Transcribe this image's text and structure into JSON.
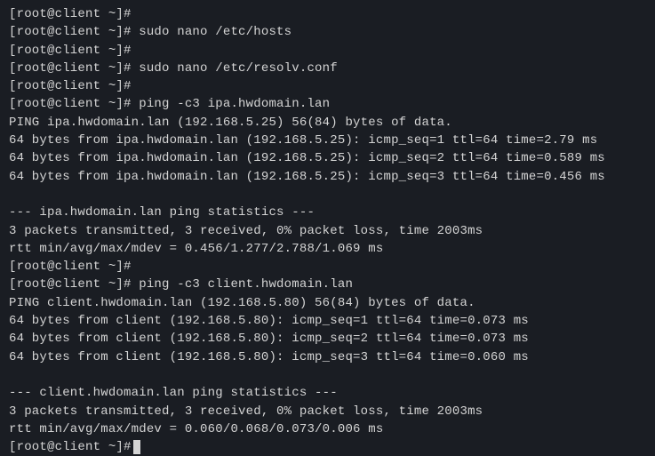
{
  "prompt": "[root@client ~]#",
  "lines": [
    {
      "type": "prompt",
      "cmd": ""
    },
    {
      "type": "prompt",
      "cmd": " sudo nano /etc/hosts"
    },
    {
      "type": "prompt",
      "cmd": ""
    },
    {
      "type": "prompt",
      "cmd": " sudo nano /etc/resolv.conf"
    },
    {
      "type": "prompt",
      "cmd": ""
    },
    {
      "type": "prompt",
      "cmd": " ping -c3 ipa.hwdomain.lan"
    },
    {
      "type": "out",
      "text": "PING ipa.hwdomain.lan (192.168.5.25) 56(84) bytes of data."
    },
    {
      "type": "out",
      "text": "64 bytes from ipa.hwdomain.lan (192.168.5.25): icmp_seq=1 ttl=64 time=2.79 ms"
    },
    {
      "type": "out",
      "text": "64 bytes from ipa.hwdomain.lan (192.168.5.25): icmp_seq=2 ttl=64 time=0.589 ms"
    },
    {
      "type": "out",
      "text": "64 bytes from ipa.hwdomain.lan (192.168.5.25): icmp_seq=3 ttl=64 time=0.456 ms"
    },
    {
      "type": "out",
      "text": ""
    },
    {
      "type": "out",
      "text": "--- ipa.hwdomain.lan ping statistics ---"
    },
    {
      "type": "out",
      "text": "3 packets transmitted, 3 received, 0% packet loss, time 2003ms"
    },
    {
      "type": "out",
      "text": "rtt min/avg/max/mdev = 0.456/1.277/2.788/1.069 ms"
    },
    {
      "type": "prompt",
      "cmd": ""
    },
    {
      "type": "prompt",
      "cmd": " ping -c3 client.hwdomain.lan"
    },
    {
      "type": "out",
      "text": "PING client.hwdomain.lan (192.168.5.80) 56(84) bytes of data."
    },
    {
      "type": "out",
      "text": "64 bytes from client (192.168.5.80): icmp_seq=1 ttl=64 time=0.073 ms"
    },
    {
      "type": "out",
      "text": "64 bytes from client (192.168.5.80): icmp_seq=2 ttl=64 time=0.073 ms"
    },
    {
      "type": "out",
      "text": "64 bytes from client (192.168.5.80): icmp_seq=3 ttl=64 time=0.060 ms"
    },
    {
      "type": "out",
      "text": ""
    },
    {
      "type": "out",
      "text": "--- client.hwdomain.lan ping statistics ---"
    },
    {
      "type": "out",
      "text": "3 packets transmitted, 3 received, 0% packet loss, time 2003ms"
    },
    {
      "type": "out",
      "text": "rtt min/avg/max/mdev = 0.060/0.068/0.073/0.006 ms"
    },
    {
      "type": "prompt",
      "cmd": "",
      "cursor": true
    }
  ]
}
